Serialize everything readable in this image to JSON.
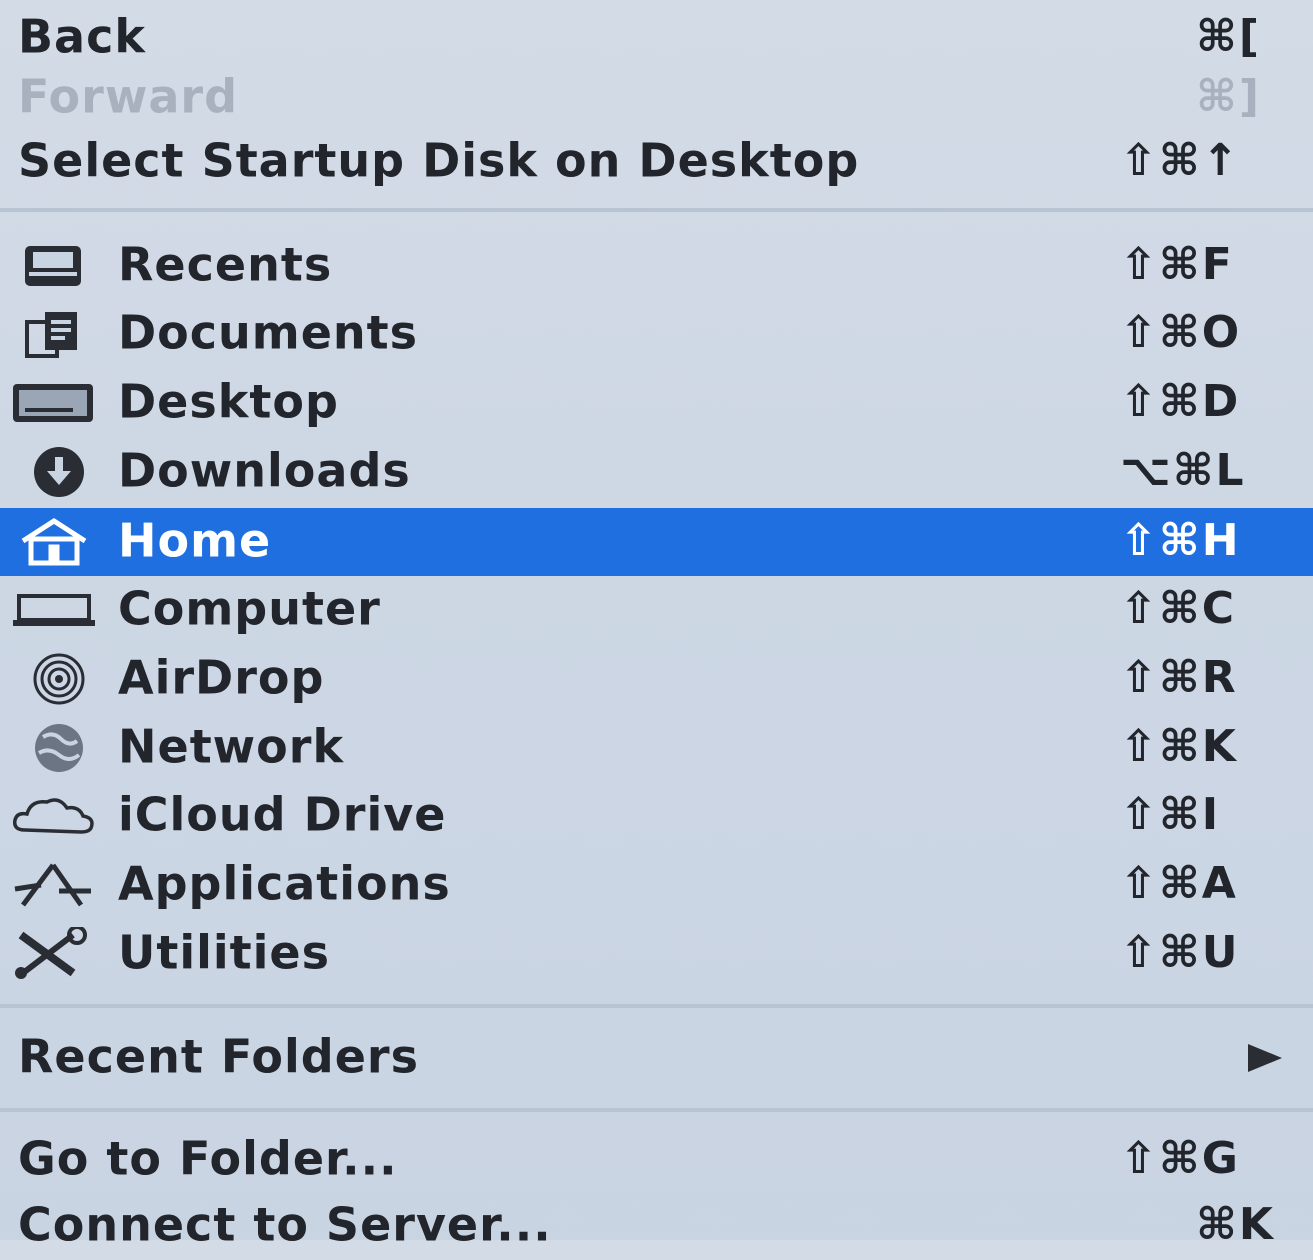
{
  "menu": {
    "items": [
      {
        "label": "Back",
        "shortcut": "⌘[",
        "enabled": true
      },
      {
        "label": "Forward",
        "shortcut": "⌘]",
        "enabled": false
      },
      {
        "label": "Select Startup Disk on Desktop",
        "shortcut": "⇧⌘↑",
        "enabled": true
      },
      {
        "label": "Recents",
        "shortcut": "⇧⌘F",
        "icon": "recents-icon"
      },
      {
        "label": "Documents",
        "shortcut": "⇧⌘O",
        "icon": "documents-icon"
      },
      {
        "label": "Desktop",
        "shortcut": "⇧⌘D",
        "icon": "desktop-icon"
      },
      {
        "label": "Downloads",
        "shortcut": "⌥⌘L",
        "icon": "downloads-icon"
      },
      {
        "label": "Home",
        "shortcut": "⇧⌘H",
        "icon": "home-icon",
        "highlighted": true
      },
      {
        "label": "Computer",
        "shortcut": "⇧⌘C",
        "icon": "computer-icon"
      },
      {
        "label": "AirDrop",
        "shortcut": "⇧⌘R",
        "icon": "airdrop-icon"
      },
      {
        "label": "Network",
        "shortcut": "⇧⌘K",
        "icon": "network-icon"
      },
      {
        "label": "iCloud Drive",
        "shortcut": "⇧⌘I",
        "icon": "icloud-icon"
      },
      {
        "label": "Applications",
        "shortcut": "⇧⌘A",
        "icon": "applications-icon"
      },
      {
        "label": "Utilities",
        "shortcut": "⇧⌘U",
        "icon": "utilities-icon"
      },
      {
        "label": "Recent Folders",
        "submenu_icon": "submenu-arrow-icon"
      },
      {
        "label": "Go to Folder...",
        "shortcut": "⇧⌘G"
      },
      {
        "label": "Connect to Server...",
        "shortcut": "⌘K"
      }
    ]
  },
  "colors": {
    "highlight": "#1f6fe0",
    "menu_background": "#cdd7e4",
    "disabled_text": "#a8b1bd",
    "text": "#22252b"
  }
}
